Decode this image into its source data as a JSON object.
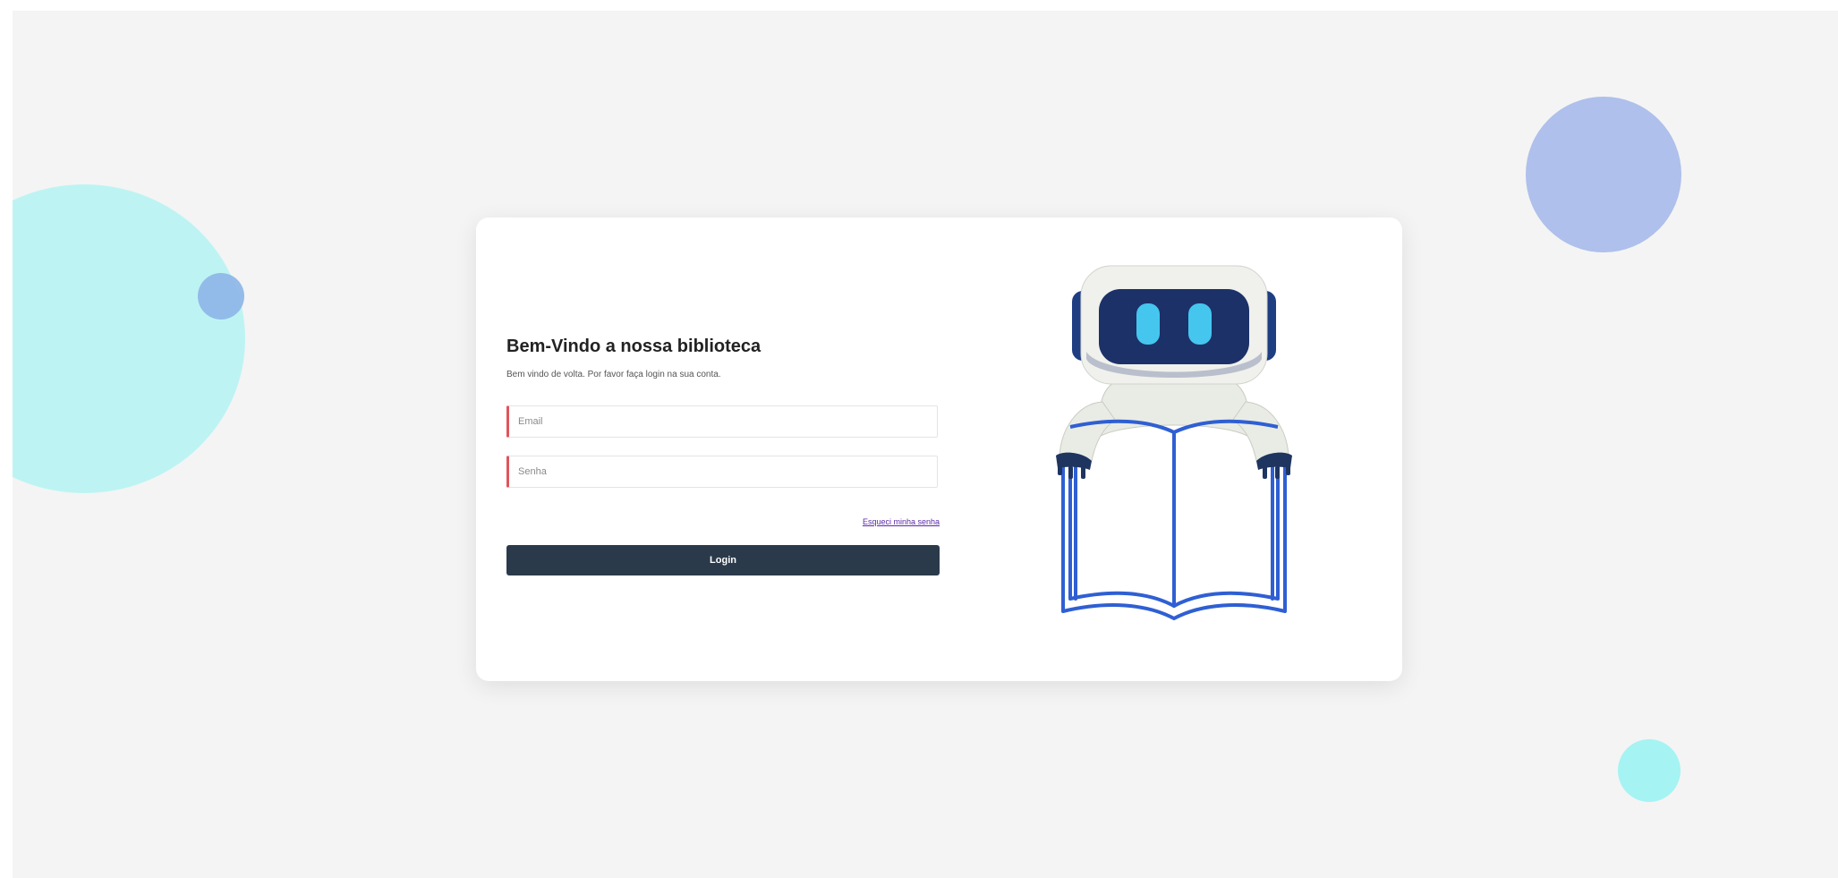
{
  "login": {
    "title": "Bem-Vindo a nossa biblioteca",
    "subtitle": "Bem vindo de volta. Por favor faça login na sua conta.",
    "email_placeholder": "Email",
    "password_placeholder": "Senha",
    "forgot_label": "Esqueci minha senha",
    "login_label": "Login"
  },
  "illustration": {
    "icon": "robot-reading-book-icon"
  },
  "colors": {
    "page_background": "#f4f4f4",
    "card_background": "#ffffff",
    "button_background": "#2b3a4b",
    "field_accent": "#e0555a",
    "link": "#5a2aa8",
    "book_stroke": "#2f5fd3",
    "blob_cyan": "#bdf4f3",
    "blob_blue": "#aec0eb"
  }
}
